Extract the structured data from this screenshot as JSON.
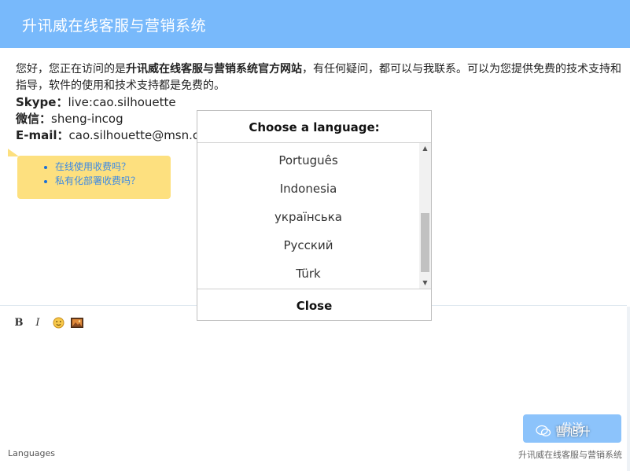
{
  "header": {
    "title": "升讯威在线客服与营销系统"
  },
  "message": {
    "intro_1": "您好，您正在访问的是",
    "intro_bold": "升讯威在线客服与营销系统官方网站",
    "intro_2": "，有任何疑问，都可以与我联系。可以为您提供免费的技术支持和指导，软件的使用和技术支持都是免费的。",
    "contacts": [
      {
        "label": "Skype：",
        "value": "live:cao.silhouette"
      },
      {
        "label": "微信：",
        "value": "sheng-incog"
      },
      {
        "label": "E-mail：",
        "value": "cao.silhouette@msn.c"
      }
    ]
  },
  "faq": {
    "links": [
      "在线使用收费吗？",
      "私有化部署收费吗？"
    ],
    "bubble_color": "#fde07f"
  },
  "editor_toolbar": {
    "bold_label": "B",
    "italic_label": "I",
    "emoji_icon": "emoji-icon",
    "image_icon": "image-icon"
  },
  "send_button": {
    "label": "发送",
    "color": "#8cc3fb"
  },
  "footer": {
    "languages_link": "Languages",
    "brand": "升讯威在线客服与营销系统",
    "watermark": "曹旭升"
  },
  "language_dialog": {
    "title": "Choose a language:",
    "options": [
      "Português",
      "Indonesia",
      "українська",
      "Русский",
      "Türk"
    ],
    "close_label": "Close"
  },
  "colors": {
    "header": "#78b9fb",
    "link": "#3b89e5"
  }
}
